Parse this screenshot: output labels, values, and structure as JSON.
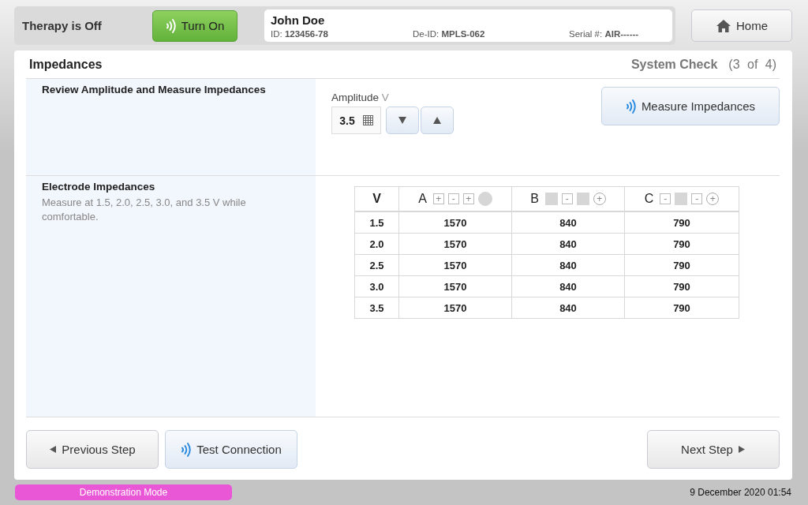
{
  "status": {
    "therapy": "Therapy is Off",
    "turn_on_button": "Turn On"
  },
  "patient": {
    "name": "John Doe",
    "id_label": "ID:",
    "id": "123456-78",
    "deid_label": "De-ID:",
    "deid": "MPLS-062",
    "serial_label": "Serial #:",
    "serial": "AIR------"
  },
  "home_button": "Home",
  "page": {
    "title": "Impedances",
    "step_title": "System Check",
    "step_count": "(3 of 4)"
  },
  "amplitude_section": {
    "heading": "Review Amplitude and Measure Impedances",
    "field_label": "Amplitude",
    "unit": "V",
    "value": "3.5",
    "measure_button": "Measure Impedances"
  },
  "electrode_section": {
    "heading": "Electrode Impedances",
    "note": "Measure at 1.5, 2.0, 2.5, 3.0, and 3.5 V while comfortable."
  },
  "table": {
    "columns": [
      {
        "label": "V"
      },
      {
        "label": "A",
        "contacts": [
          {
            "kind": "plus",
            "symbol": "+"
          },
          {
            "kind": "minus",
            "symbol": "-"
          },
          {
            "kind": "plus",
            "symbol": "+"
          },
          {
            "kind": "case-off"
          }
        ]
      },
      {
        "label": "B",
        "contacts": [
          {
            "kind": "off"
          },
          {
            "kind": "minus",
            "symbol": "-"
          },
          {
            "kind": "off"
          },
          {
            "kind": "case-plus",
            "symbol": "+"
          }
        ]
      },
      {
        "label": "C",
        "contacts": [
          {
            "kind": "minus",
            "symbol": "-"
          },
          {
            "kind": "off"
          },
          {
            "kind": "minus",
            "symbol": "-"
          },
          {
            "kind": "case-plus",
            "symbol": "+"
          }
        ]
      }
    ],
    "rows": [
      [
        "1.5",
        "1570",
        "840",
        "790"
      ],
      [
        "2.0",
        "1570",
        "840",
        "790"
      ],
      [
        "2.5",
        "1570",
        "840",
        "790"
      ],
      [
        "3.0",
        "1570",
        "840",
        "790"
      ],
      [
        "3.5",
        "1570",
        "840",
        "790"
      ]
    ]
  },
  "footer": {
    "previous_button": "Previous Step",
    "test_button": "Test Connection",
    "next_button": "Next Step"
  },
  "demo_badge": "Demonstration Mode",
  "datetime": "9 December 2020 01:54"
}
